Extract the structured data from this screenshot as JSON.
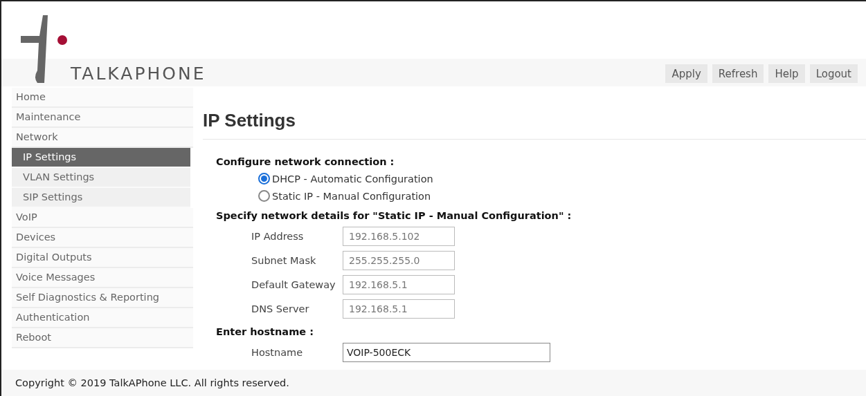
{
  "header": {
    "logo_text": "TALKAPHONE",
    "buttons": [
      "Apply",
      "Refresh",
      "Help",
      "Logout"
    ]
  },
  "sidebar": {
    "items": [
      {
        "label": "Home",
        "selected": false
      },
      {
        "label": "Maintenance",
        "selected": false
      },
      {
        "label": "Network",
        "selected": false,
        "children": [
          {
            "label": "IP Settings",
            "selected": true
          },
          {
            "label": "VLAN Settings",
            "selected": false
          },
          {
            "label": "SIP Settings",
            "selected": false
          }
        ]
      },
      {
        "label": "VoIP",
        "selected": false
      },
      {
        "label": "Devices",
        "selected": false
      },
      {
        "label": "Digital Outputs",
        "selected": false
      },
      {
        "label": "Voice Messages",
        "selected": false
      },
      {
        "label": "Self Diagnostics & Reporting",
        "selected": false
      },
      {
        "label": "Authentication",
        "selected": false
      },
      {
        "label": "Reboot",
        "selected": false
      }
    ]
  },
  "content": {
    "title": "IP Settings",
    "sections": [
      {
        "kind": "radios",
        "heading": "Configure network connection :",
        "options": [
          {
            "label": "DHCP - Automatic Configuration",
            "selected": true
          },
          {
            "label": "Static IP - Manual Configuration",
            "selected": false
          }
        ]
      },
      {
        "kind": "fields",
        "heading": "Specify network details for \"Static IP - Manual Configuration\" :",
        "fields": [
          {
            "label": "IP Address",
            "value": "192.168.5.102",
            "disabled": true
          },
          {
            "label": "Subnet Mask",
            "value": "255.255.255.0",
            "disabled": true
          },
          {
            "label": "Default Gateway",
            "value": "192.168.5.1",
            "disabled": true
          },
          {
            "label": "DNS Server",
            "value": "192.168.5.1",
            "disabled": true
          }
        ]
      },
      {
        "kind": "fields",
        "heading": "Enter hostname :",
        "fields": [
          {
            "label": "Hostname",
            "value": "VOIP-500ECK",
            "disabled": false,
            "wide": true
          }
        ]
      }
    ]
  },
  "footer": {
    "text": "Copyright © 2019 TalkAPhone LLC. All rights reserved."
  }
}
